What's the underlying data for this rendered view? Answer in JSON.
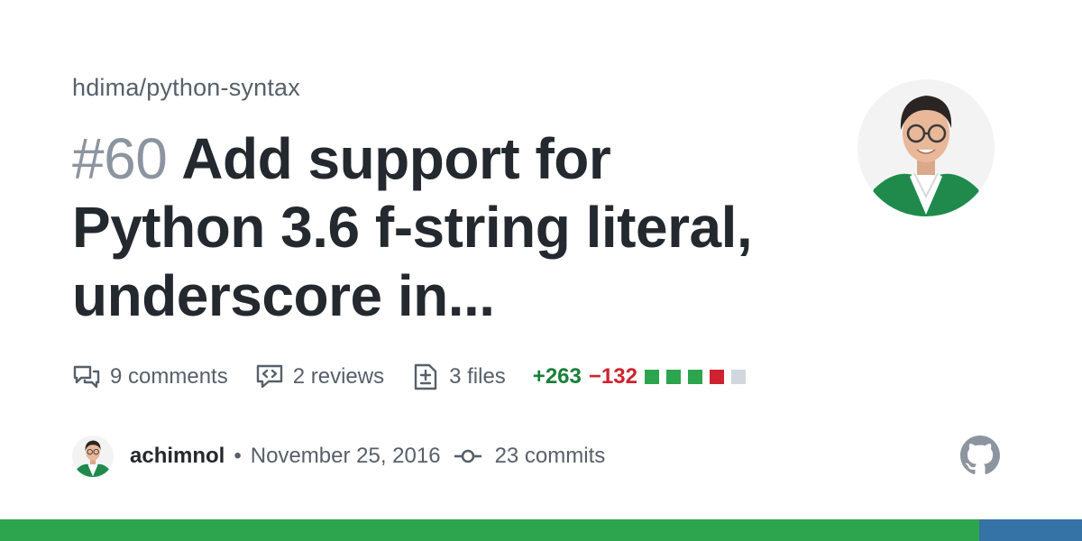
{
  "repo": "hdima/python-syntax",
  "pr": {
    "number": "#60",
    "title": "Add support for Python 3.6 f-string literal, underscore in..."
  },
  "stats": {
    "comments": "9 comments",
    "reviews": "2 reviews",
    "files": "3 files",
    "additions": "+263",
    "deletions": "−132",
    "diff_blocks": [
      "green",
      "green",
      "green",
      "red",
      "neutral"
    ]
  },
  "meta": {
    "author": "achimnol",
    "separator": "•",
    "date": "November 25, 2016",
    "commits": "23 commits"
  },
  "icons": {
    "comments": "comment-discussion-icon",
    "reviews": "code-review-icon",
    "files": "file-diff-icon",
    "commits": "git-commit-icon",
    "brand": "github-mark-icon"
  },
  "colors": {
    "additions": "#1a7f37",
    "deletions": "#cf222e",
    "language_bar_primary": "#2da44e",
    "language_bar_secondary": "#3572a5"
  }
}
